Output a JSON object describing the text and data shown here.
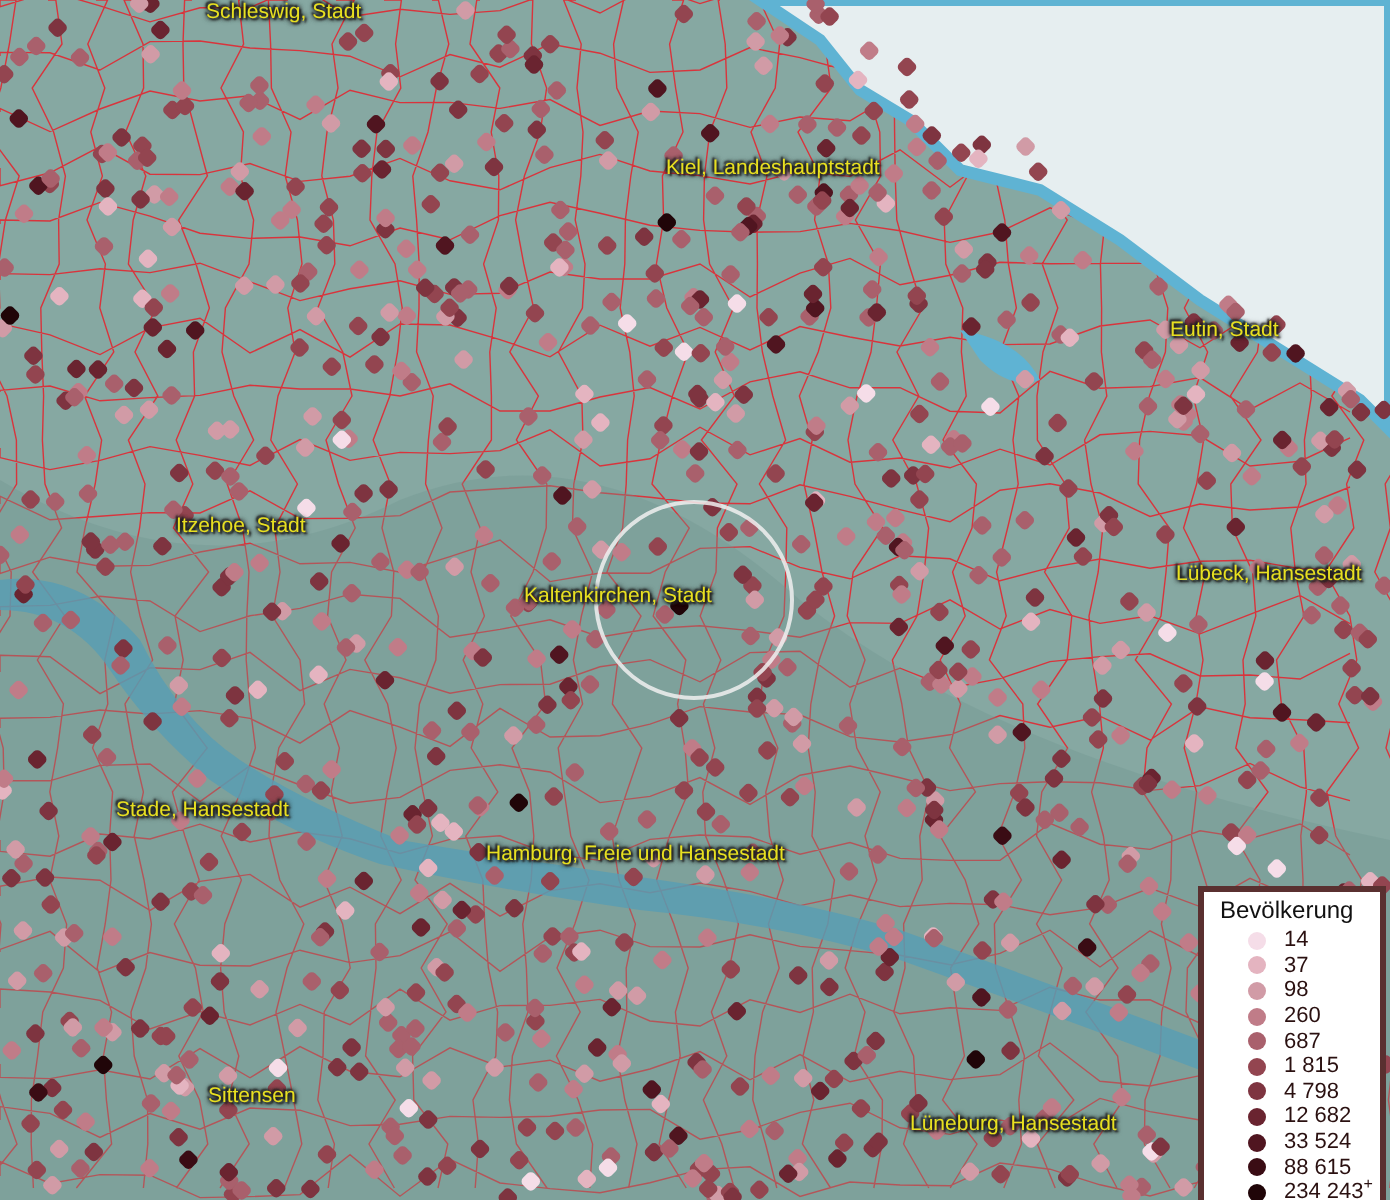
{
  "map": {
    "labels": [
      {
        "text": "Schleswig, Stadt"
      },
      {
        "text": "Kiel, Landeshauptstadt"
      },
      {
        "text": "Eutin, Stadt"
      },
      {
        "text": "Itzehoe, Stadt"
      },
      {
        "text": "Kaltenkirchen, Stadt"
      },
      {
        "text": "Lübeck, Hansestadt"
      },
      {
        "text": "Stade, Hansestadt"
      },
      {
        "text": "Hamburg, Freie und Hansestadt"
      },
      {
        "text": "Sittensen"
      },
      {
        "text": "Lüneburg, Hansestadt"
      }
    ]
  },
  "legend": {
    "title": "Bevölkerung",
    "items": [
      {
        "label": "14",
        "color": "#f5dde8"
      },
      {
        "label": "37",
        "color": "#e4b4c0"
      },
      {
        "label": "98",
        "color": "#d19ba6"
      },
      {
        "label": "260",
        "color": "#c07c88"
      },
      {
        "label": "687",
        "color": "#a9606c"
      },
      {
        "label": "1 815",
        "color": "#934550"
      },
      {
        "label": "4 798",
        "color": "#7e3440"
      },
      {
        "label": "12 682",
        "color": "#6a2430"
      },
      {
        "label": "33 524",
        "color": "#501520"
      },
      {
        "label": "88 615",
        "color": "#3a0c14"
      },
      {
        "label": "234 243$^{+}$",
        "color": "#200508"
      }
    ]
  }
}
